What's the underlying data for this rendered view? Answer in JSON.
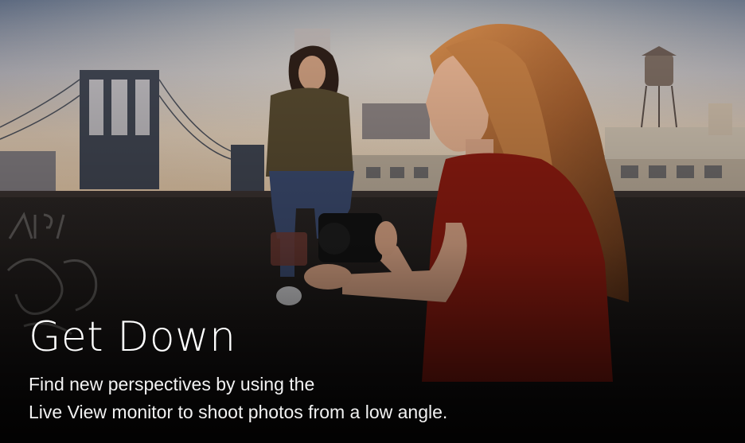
{
  "slide": {
    "title": "Get Down",
    "description_line1": "Find new perspectives by using the",
    "description_line2": "Live View monitor to shoot photos from a low angle."
  },
  "colors": {
    "text": "#ffffff",
    "sky_top": "#5f6b82",
    "sky_glow": "#e8c7a0",
    "shirt_red": "#8e1d12",
    "hair": "#b9733c"
  }
}
